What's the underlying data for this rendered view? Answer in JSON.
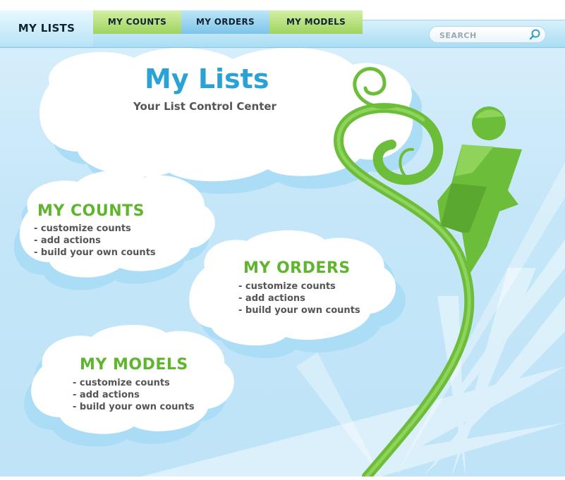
{
  "nav": {
    "tabs": [
      {
        "label": "MY LISTS",
        "active": true
      },
      {
        "label": "MY COUNTS",
        "active": false
      },
      {
        "label": "MY ORDERS",
        "active": false
      },
      {
        "label": "MY MODELS",
        "active": false
      }
    ],
    "search": {
      "placeholder": "SEARCH",
      "icon": "search-icon"
    }
  },
  "hero": {
    "title": "My Lists",
    "subtitle": "Your List Control Center"
  },
  "sections": [
    {
      "title": "MY COUNTS",
      "items": [
        "customize counts",
        "add actions",
        "build your own counts"
      ]
    },
    {
      "title": "MY ORDERS",
      "items": [
        "customize counts",
        "add actions",
        "build your own counts"
      ]
    },
    {
      "title": "MY MODELS",
      "items": [
        "customize counts",
        "add actions",
        "build your own counts"
      ]
    }
  ],
  "colors": {
    "title_blue": "#2aa2d6",
    "section_green": "#5fb52e",
    "vine_green": "#6cbd3a",
    "text_gray": "#555555"
  }
}
